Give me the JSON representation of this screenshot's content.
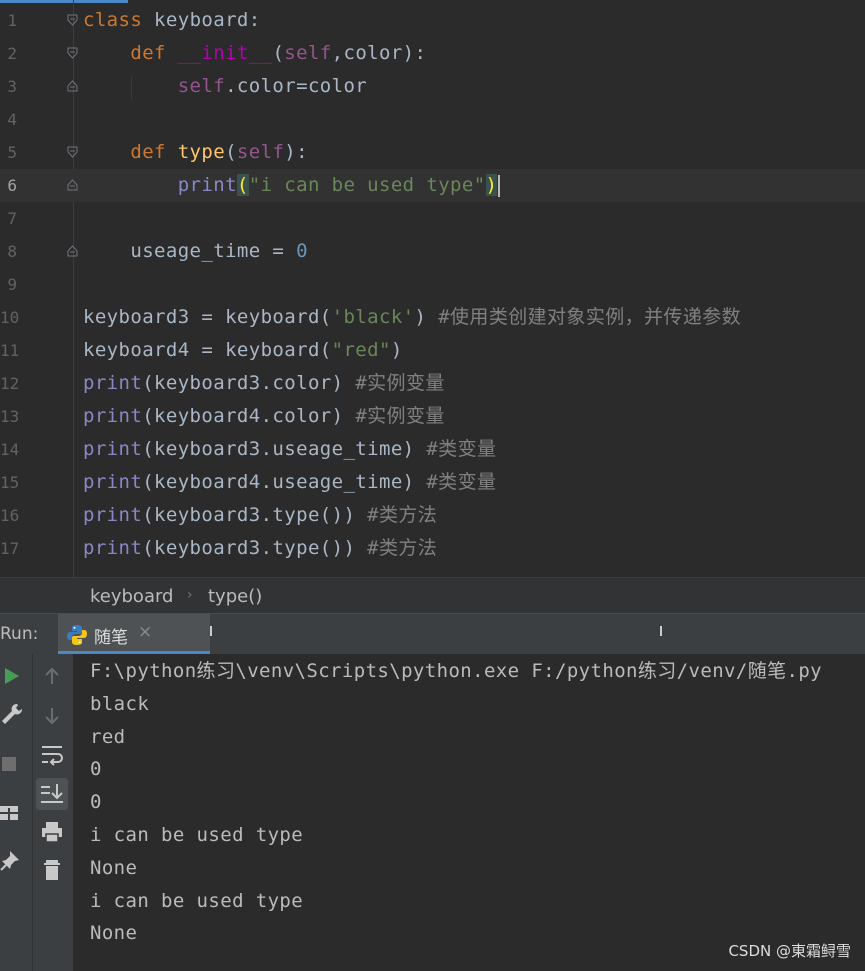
{
  "editor": {
    "lines": [
      {
        "n": "1",
        "segs": [
          [
            "kw",
            "class "
          ],
          [
            "p",
            "keyboard:"
          ]
        ]
      },
      {
        "n": "2",
        "segs": [
          [
            "p",
            "    "
          ],
          [
            "kw",
            "def "
          ],
          [
            "magic",
            "__init__"
          ],
          [
            "p",
            "("
          ],
          [
            "self",
            "self"
          ],
          [
            "p",
            ",color):"
          ]
        ]
      },
      {
        "n": "3",
        "segs": [
          [
            "p",
            "        "
          ],
          [
            "self",
            "self"
          ],
          [
            "p",
            ".color=color"
          ]
        ]
      },
      {
        "n": "4",
        "segs": []
      },
      {
        "n": "5",
        "segs": [
          [
            "p",
            "    "
          ],
          [
            "kw",
            "def "
          ],
          [
            "fn",
            "type"
          ],
          [
            "p",
            "("
          ],
          [
            "self",
            "self"
          ],
          [
            "p",
            "):"
          ]
        ]
      },
      {
        "n": "6",
        "segs": [
          [
            "p",
            "        "
          ],
          [
            "bi",
            "print"
          ],
          [
            "brace",
            "("
          ],
          [
            "str",
            "\"i can be used type\""
          ],
          [
            "brace",
            ")"
          ]
        ]
      },
      {
        "n": "7",
        "segs": []
      },
      {
        "n": "8",
        "segs": [
          [
            "p",
            "    useage_time = "
          ],
          [
            "num",
            "0"
          ]
        ]
      },
      {
        "n": "9",
        "segs": []
      },
      {
        "n": "10",
        "segs": [
          [
            "p",
            "keyboard3 = keyboard("
          ],
          [
            "str",
            "'black'"
          ],
          [
            "p",
            ") "
          ],
          [
            "cmt",
            "#使用类创建对象实例，并传递参数"
          ]
        ]
      },
      {
        "n": "11",
        "segs": [
          [
            "p",
            "keyboard4 = keyboard("
          ],
          [
            "str",
            "\"red\""
          ],
          [
            "p",
            ")"
          ]
        ]
      },
      {
        "n": "12",
        "segs": [
          [
            "bi",
            "print"
          ],
          [
            "p",
            "(keyboard3.color) "
          ],
          [
            "cmt",
            "#实例变量"
          ]
        ]
      },
      {
        "n": "13",
        "segs": [
          [
            "bi",
            "print"
          ],
          [
            "p",
            "(keyboard4.color) "
          ],
          [
            "cmt",
            "#实例变量"
          ]
        ]
      },
      {
        "n": "14",
        "segs": [
          [
            "bi",
            "print"
          ],
          [
            "p",
            "(keyboard3.useage_time) "
          ],
          [
            "cmt",
            "#类变量"
          ]
        ]
      },
      {
        "n": "15",
        "segs": [
          [
            "bi",
            "print"
          ],
          [
            "p",
            "(keyboard4.useage_time) "
          ],
          [
            "cmt",
            "#类变量"
          ]
        ]
      },
      {
        "n": "16",
        "segs": [
          [
            "bi",
            "print"
          ],
          [
            "p",
            "(keyboard3.type()) "
          ],
          [
            "cmt",
            "#类方法"
          ]
        ]
      },
      {
        "n": "17",
        "segs": [
          [
            "bi",
            "print"
          ],
          [
            "p",
            "(keyboard3.type()) "
          ],
          [
            "cmt",
            "#类方法"
          ]
        ]
      }
    ],
    "current_line": "6"
  },
  "breadcrumb": {
    "items": [
      "keyboard",
      "type()"
    ]
  },
  "run": {
    "label": "Run:",
    "tab_name": "随笔",
    "tab_close": "×",
    "output": [
      "F:\\python练习\\venv\\Scripts\\python.exe F:/python练习/venv/随笔.py",
      "black",
      "red",
      "0",
      "0",
      "i can be used type",
      "None",
      "i can be used type",
      "None"
    ]
  },
  "watermark": "CSDN @東霜鲟雪",
  "colors": {
    "keyword": "#cc7832",
    "string": "#6a8759",
    "number": "#6897bb",
    "builtin": "#8888c6",
    "self": "#94558d",
    "magic": "#b200b2",
    "function": "#ffc66d",
    "comment": "#808080"
  }
}
